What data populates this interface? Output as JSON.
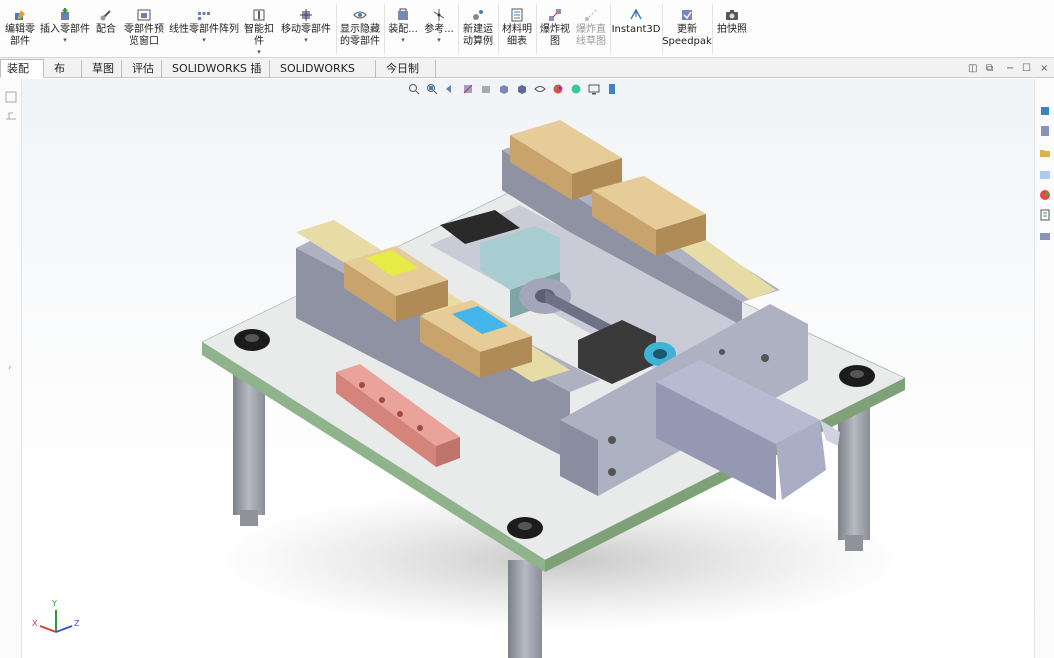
{
  "ribbon": {
    "buttons": [
      {
        "label": "编辑零\n部件",
        "icon": "edit-component-icon",
        "disabled": false,
        "dropdown": false
      },
      {
        "label": "插入零部件",
        "icon": "insert-component-icon",
        "disabled": false,
        "dropdown": true
      },
      {
        "label": "配合",
        "icon": "mate-icon",
        "disabled": false,
        "dropdown": false
      },
      {
        "label": "零部件预\n览窗口",
        "icon": "component-preview-icon",
        "disabled": false,
        "dropdown": false
      },
      {
        "label": "线性零部件阵列",
        "icon": "linear-pattern-icon",
        "disabled": false,
        "dropdown": true
      },
      {
        "label": "智能扣\n件",
        "icon": "smart-fastener-icon",
        "disabled": false,
        "dropdown": true
      },
      {
        "label": "移动零部件",
        "icon": "move-component-icon",
        "disabled": false,
        "dropdown": true
      },
      {
        "label": "显示隐藏\n的零部件",
        "icon": "show-hidden-icon",
        "disabled": false,
        "dropdown": false
      },
      {
        "label": "装配...",
        "icon": "assembly-feature-icon",
        "disabled": false,
        "dropdown": true
      },
      {
        "label": "参考...",
        "icon": "reference-geometry-icon",
        "disabled": false,
        "dropdown": true
      },
      {
        "label": "新建运\n动算例",
        "icon": "motion-study-icon",
        "disabled": false,
        "dropdown": false
      },
      {
        "label": "材料明\n细表",
        "icon": "bom-icon",
        "disabled": false,
        "dropdown": false
      },
      {
        "label": "爆炸视\n图",
        "icon": "exploded-view-icon",
        "disabled": false,
        "dropdown": false
      },
      {
        "label": "爆炸直\n线草图",
        "icon": "explode-line-icon",
        "disabled": true,
        "dropdown": false
      },
      {
        "label": "Instant3D",
        "icon": "instant3d-icon",
        "disabled": false,
        "dropdown": false
      },
      {
        "label": "更新\nSpeedpak",
        "icon": "speedpak-icon",
        "disabled": false,
        "dropdown": false
      },
      {
        "label": "拍快照",
        "icon": "snapshot-icon",
        "disabled": false,
        "dropdown": false
      }
    ]
  },
  "tabs": [
    {
      "label": "装配体",
      "active": true
    },
    {
      "label": "布局",
      "active": false
    },
    {
      "label": "草图",
      "active": false
    },
    {
      "label": "评估",
      "active": false
    },
    {
      "label": "SOLIDWORKS 插件",
      "active": false
    },
    {
      "label": "SOLIDWORKS MBD",
      "active": false
    },
    {
      "label": "今日制造",
      "active": false
    }
  ],
  "viewport": {
    "triad": {
      "x_label": "X",
      "y_label": "Y",
      "z_label": "Z"
    },
    "colors": {
      "plate": "#e9eaea",
      "plate_edge": "#8fb38a",
      "body": "#9c9fb0",
      "block": "#d9bf8c",
      "rail": "#e8dca6",
      "highlight_yellow": "#e6ec46",
      "highlight_blue": "#44b6ec",
      "pink_part": "#e29a93",
      "motor": "#a9adc6"
    }
  }
}
